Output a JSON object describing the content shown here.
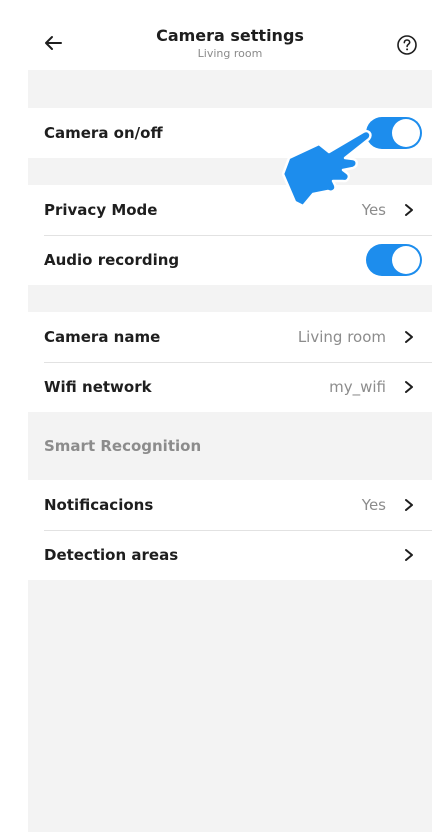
{
  "header": {
    "title": "Camera settings",
    "subtitle": "Living room",
    "back_icon": "arrow-left-icon",
    "help_icon": "question-circle-icon"
  },
  "rows": {
    "camera_onoff": {
      "label": "Camera on/off",
      "toggle": true
    },
    "privacy_mode": {
      "label": "Privacy Mode",
      "value": "Yes"
    },
    "audio_recording": {
      "label": "Audio recording",
      "toggle": true
    },
    "camera_name": {
      "label": "Camera name",
      "value": "Living room"
    },
    "wifi_network": {
      "label": "Wifi network",
      "value": "my_wifi"
    },
    "notifications": {
      "label": "Notificacions",
      "value": "Yes"
    },
    "detection_areas": {
      "label": "Detection areas"
    }
  },
  "sections": {
    "smart_recognition": "Smart Recognition"
  },
  "colors": {
    "accent": "#1d8ded",
    "background": "#f3f3f3",
    "text": "#1e1e1e",
    "muted": "#8c8c8c"
  },
  "overlay": {
    "icon": "pointing-hand-icon"
  }
}
